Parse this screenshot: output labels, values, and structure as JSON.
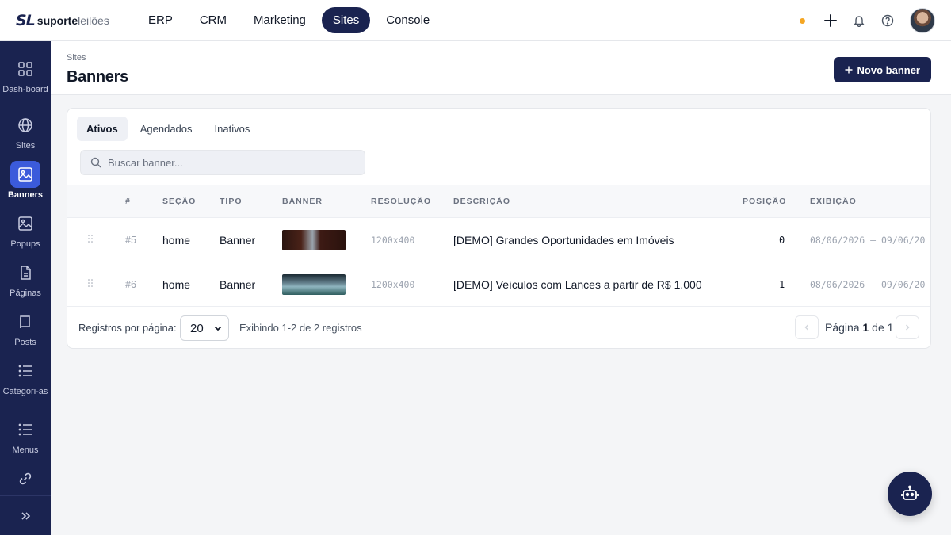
{
  "brand": {
    "logo_mark": "SL",
    "name_bold": "suporte",
    "name_light": "leilões"
  },
  "topnav": [
    {
      "label": "ERP"
    },
    {
      "label": "CRM"
    },
    {
      "label": "Marketing"
    },
    {
      "label": "Sites",
      "active": true
    },
    {
      "label": "Console"
    }
  ],
  "topbar_icons": [
    "status-dot",
    "plus-icon",
    "bell-icon",
    "help-icon",
    "avatar"
  ],
  "sidebar": {
    "items": [
      {
        "label": "Dash-board",
        "icon": "dashboard-icon"
      },
      {
        "label": "Sites",
        "icon": "globe-icon"
      },
      {
        "label": "Banners",
        "icon": "image-icon",
        "active": true
      },
      {
        "label": "Popups",
        "icon": "image-icon"
      },
      {
        "label": "Páginas",
        "icon": "file-icon"
      },
      {
        "label": "Posts",
        "icon": "book-icon"
      },
      {
        "label": "Categori-as",
        "icon": "list-icon"
      },
      {
        "label": "Menus",
        "icon": "list-icon"
      },
      {
        "label": "",
        "icon": "link-icon"
      }
    ],
    "expand_icon": "chevrons-right-icon"
  },
  "header": {
    "breadcrumb": "Sites",
    "title": "Banners",
    "new_button": "Novo banner"
  },
  "tabs": [
    {
      "label": "Ativos",
      "active": true
    },
    {
      "label": "Agendados"
    },
    {
      "label": "Inativos"
    }
  ],
  "search": {
    "placeholder": "Buscar banner...",
    "value": ""
  },
  "table": {
    "columns": [
      "#",
      "SEÇÃO",
      "TIPO",
      "BANNER",
      "RESOLUÇÃO",
      "DESCRIÇÃO",
      "POSIÇÃO",
      "EXIBIÇÃO"
    ],
    "rows": [
      {
        "id": "#5",
        "section": "home",
        "type": "Banner",
        "resolution": "1200x400",
        "description": "[DEMO] Grandes Oportunidades em Imóveis",
        "position": "0",
        "display": "08/06/2026 — 09/06/20"
      },
      {
        "id": "#6",
        "section": "home",
        "type": "Banner",
        "resolution": "1200x400",
        "description": "[DEMO] Veículos com Lances a partir de R$ 1.000",
        "position": "1",
        "display": "08/06/2026 — 09/06/20"
      }
    ]
  },
  "footer": {
    "per_page_label": "Registros por página:",
    "per_page_value": "20",
    "showing": "Exibindo 1-2 de 2 registros",
    "page_prefix": "Página",
    "page_current": "1",
    "page_sep": "de",
    "page_total": "1"
  },
  "colors": {
    "brand_navy": "#1a2350",
    "active_blue": "#3b5bdb",
    "status_dot": "#f5a623"
  }
}
